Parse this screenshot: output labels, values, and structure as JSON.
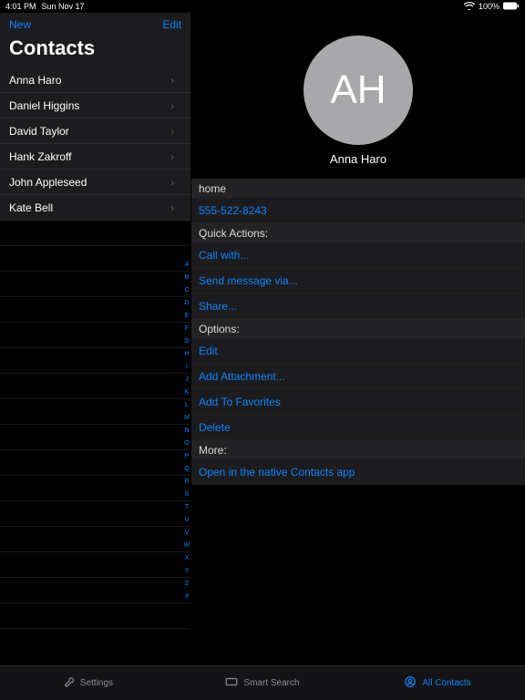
{
  "status": {
    "time": "4:01 PM",
    "date": "Sun Nov 17",
    "wifi": "􀙇",
    "battery": "100%"
  },
  "sidebar": {
    "new": "New",
    "edit": "Edit",
    "title": "Contacts",
    "items": [
      "Anna Haro",
      "Daniel Higgins",
      "David Taylor",
      "Hank Zakroff",
      "John Appleseed",
      "Kate Bell"
    ],
    "index": [
      "A",
      "B",
      "C",
      "D",
      "E",
      "F",
      "G",
      "H",
      "I",
      "J",
      "K",
      "L",
      "M",
      "N",
      "O",
      "P",
      "Q",
      "R",
      "S",
      "T",
      "U",
      "V",
      "W",
      "X",
      "Y",
      "Z",
      "#"
    ]
  },
  "detail": {
    "initials": "AH",
    "name": "Anna Haro",
    "sections": {
      "home": "home",
      "phone": "555-522-8243",
      "quick_actions_header": "Quick Actions:",
      "call_with": "Call with...",
      "send_message": "Send message via...",
      "share": "Share...",
      "options_header": "Options:",
      "edit": "Edit",
      "add_attachment": "Add Attachment...",
      "add_favorites": "Add To Favorites",
      "delete": "Delete",
      "more_header": "More:",
      "open_native": "Open in the native Contacts app"
    }
  },
  "tabs": {
    "settings": "Settings",
    "smart_search": "Smart Search",
    "all_contacts": "All Contacts"
  }
}
